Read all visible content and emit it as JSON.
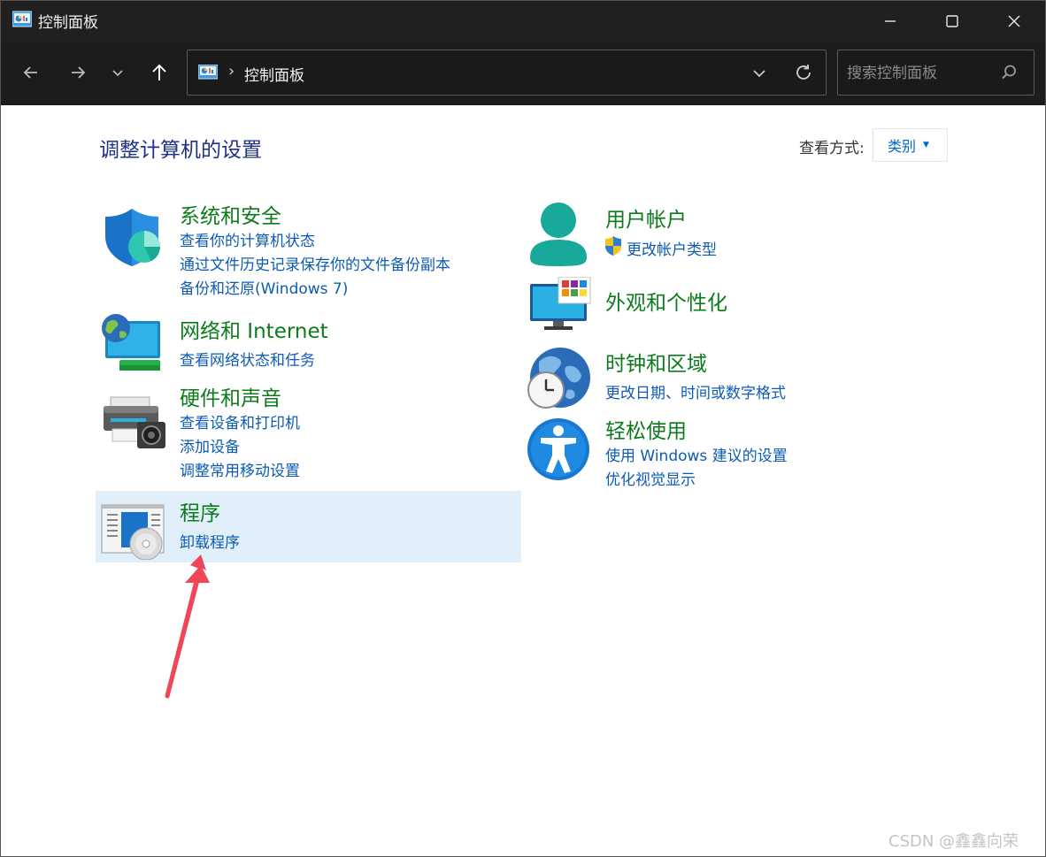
{
  "window": {
    "title": "控制面板",
    "minimize_icon": "minimize-icon",
    "maximize_icon": "maximize-icon",
    "close_icon": "close-icon"
  },
  "nav": {
    "address_text": "控制面板",
    "separator": "›",
    "search_placeholder": "搜索控制面板"
  },
  "main": {
    "title": "调整计算机的设置",
    "view_by_label": "查看方式:",
    "view_by_value": "类别"
  },
  "categories": [
    {
      "title": "系统和安全",
      "icon": "shield-icon",
      "links": [
        "查看你的计算机状态",
        "通过文件历史记录保存你的文件备份副本",
        "备份和还原(Windows 7)"
      ]
    },
    {
      "title": "网络和 Internet",
      "icon": "network-globe-icon",
      "links": [
        "查看网络状态和任务"
      ]
    },
    {
      "title": "硬件和声音",
      "icon": "printer-icon",
      "links": [
        "查看设备和打印机",
        "添加设备",
        "调整常用移动设置"
      ]
    },
    {
      "title": "程序",
      "icon": "programs-disc-icon",
      "links": [
        "卸载程序"
      ]
    },
    {
      "title": "用户帐户",
      "icon": "user-icon",
      "links": [
        "更改帐户类型"
      ]
    },
    {
      "title": "外观和个性化",
      "icon": "monitor-icon",
      "links": []
    },
    {
      "title": "时钟和区域",
      "icon": "clock-globe-icon",
      "links": [
        "更改日期、时间或数字格式"
      ]
    },
    {
      "title": "轻松使用",
      "icon": "accessibility-icon",
      "links": [
        "使用 Windows 建议的设置",
        "优化视觉显示"
      ]
    }
  ],
  "colors": {
    "category_title": "#0c7b1c",
    "link": "#0d5bb5",
    "page_title": "#1e3287",
    "highlight": "#e1effb",
    "annotation_arrow": "#f0465a"
  },
  "watermark": "CSDN @鑫鑫向荣"
}
